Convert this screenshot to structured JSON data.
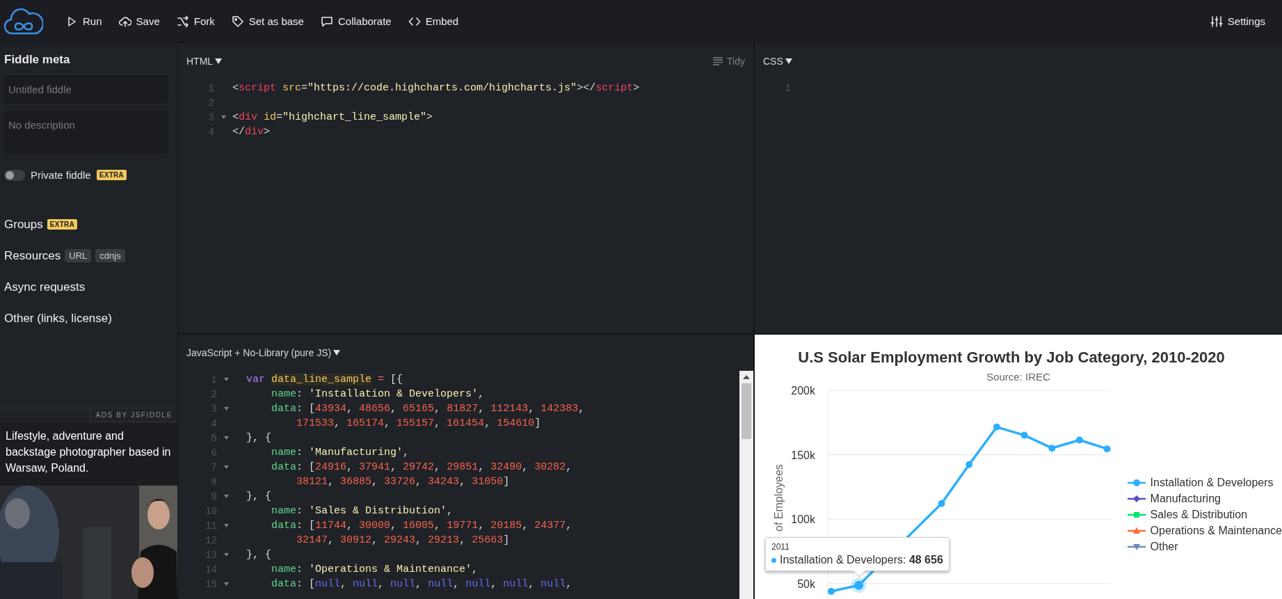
{
  "toolbar": {
    "actions": [
      {
        "label": "Run"
      },
      {
        "label": "Save"
      },
      {
        "label": "Fork"
      },
      {
        "label": "Set as base"
      },
      {
        "label": "Collaborate"
      },
      {
        "label": "Embed"
      }
    ],
    "settings": {
      "label": "Settings"
    }
  },
  "sidebar": {
    "title": "Fiddle meta",
    "title_field": {
      "placeholder": "Untitled fiddle"
    },
    "description_field": {
      "placeholder": "No description"
    },
    "private_toggle": {
      "label": "Private fiddle",
      "on": false,
      "badge": "EXTRA"
    },
    "sections": [
      {
        "label": "Groups",
        "badges": [
          {
            "text": "EXTRA",
            "kind": "extra"
          }
        ]
      },
      {
        "label": "Resources",
        "badges": [
          {
            "text": "URL",
            "kind": "tag"
          },
          {
            "text": "cdnjs",
            "kind": "tag"
          }
        ]
      },
      {
        "label": "Async requests"
      },
      {
        "label": "Other (links, license)"
      }
    ],
    "ad": {
      "label": "ADS BY JSFIDDLE",
      "text": "Lifestyle, adventure and backstage photographer based in Warsaw, Poland."
    }
  },
  "editors": {
    "html": {
      "title": "HTML",
      "tidy": "Tidy",
      "lines": [
        {
          "num": "1",
          "fold": false,
          "tokens": [
            {
              "kind": "punct",
              "text": "<"
            },
            {
              "kind": "tag",
              "text": "script"
            },
            {
              "kind": "attr",
              "text": " src"
            },
            {
              "kind": "punct",
              "text": "="
            },
            {
              "kind": "string",
              "text": "\"https://code.highcharts.com/highcharts.js\""
            },
            {
              "kind": "punct",
              "text": "></"
            },
            {
              "kind": "tag",
              "text": "script"
            },
            {
              "kind": "punct",
              "text": ">"
            }
          ]
        },
        {
          "num": "2",
          "fold": false
        },
        {
          "num": "3",
          "fold": true,
          "tokens": [
            {
              "kind": "punct",
              "text": "<"
            },
            {
              "kind": "tag",
              "text": "div"
            },
            {
              "kind": "attr",
              "text": " id"
            },
            {
              "kind": "punct",
              "text": "="
            },
            {
              "kind": "string",
              "text": "\"highchart_line_sample\""
            },
            {
              "kind": "punct",
              "text": ">"
            }
          ]
        },
        {
          "num": "4",
          "fold": false,
          "tokens": [
            {
              "kind": "punct",
              "text": "</"
            },
            {
              "kind": "tag",
              "text": "div"
            },
            {
              "kind": "punct",
              "text": ">"
            }
          ]
        }
      ]
    },
    "css": {
      "title": "CSS",
      "lines": [
        {
          "num": "1",
          "fold": false
        }
      ]
    },
    "js": {
      "title": "JavaScript + No-Library (pure JS)",
      "lines": [
        {
          "num": "1",
          "fold": true,
          "tokens": [
            {
              "kind": "keyword",
              "text": "var "
            },
            {
              "kind": "match",
              "text": "data_line_sample"
            },
            {
              "kind": "operator",
              "text": " = "
            },
            {
              "kind": "punct",
              "text": "[{"
            }
          ]
        },
        {
          "num": "2",
          "fold": false,
          "tokens": [
            {
              "kind": "property",
              "text": "    name"
            },
            {
              "kind": "punct",
              "text": ": "
            },
            {
              "kind": "string",
              "text": "'Installation & Developers'"
            },
            {
              "kind": "punct",
              "text": ","
            }
          ]
        },
        {
          "num": "3",
          "fold": true,
          "tokens": [
            {
              "kind": "property",
              "text": "    data"
            },
            {
              "kind": "punct",
              "text": ": ["
            },
            {
              "kind": "number",
              "text": "43934"
            },
            {
              "kind": "punct",
              "text": ", "
            },
            {
              "kind": "number",
              "text": "48656"
            },
            {
              "kind": "punct",
              "text": ", "
            },
            {
              "kind": "number",
              "text": "65165"
            },
            {
              "kind": "punct",
              "text": ", "
            },
            {
              "kind": "number",
              "text": "81827"
            },
            {
              "kind": "punct",
              "text": ", "
            },
            {
              "kind": "number",
              "text": "112143"
            },
            {
              "kind": "punct",
              "text": ", "
            },
            {
              "kind": "number",
              "text": "142383"
            },
            {
              "kind": "punct",
              "text": ","
            }
          ]
        },
        {
          "num": "4",
          "fold": false,
          "tokens": [
            {
              "kind": "number",
              "text": "        171533"
            },
            {
              "kind": "punct",
              "text": ", "
            },
            {
              "kind": "number",
              "text": "165174"
            },
            {
              "kind": "punct",
              "text": ", "
            },
            {
              "kind": "number",
              "text": "155157"
            },
            {
              "kind": "punct",
              "text": ", "
            },
            {
              "kind": "number",
              "text": "161454"
            },
            {
              "kind": "punct",
              "text": ", "
            },
            {
              "kind": "number",
              "text": "154610"
            },
            {
              "kind": "punct",
              "text": "]"
            }
          ]
        },
        {
          "num": "5",
          "fold": true,
          "tokens": [
            {
              "kind": "punct",
              "text": "}, {"
            }
          ]
        },
        {
          "num": "6",
          "fold": false,
          "tokens": [
            {
              "kind": "property",
              "text": "    name"
            },
            {
              "kind": "punct",
              "text": ": "
            },
            {
              "kind": "string",
              "text": "'Manufacturing'"
            },
            {
              "kind": "punct",
              "text": ","
            }
          ]
        },
        {
          "num": "7",
          "fold": true,
          "tokens": [
            {
              "kind": "property",
              "text": "    data"
            },
            {
              "kind": "punct",
              "text": ": ["
            },
            {
              "kind": "number",
              "text": "24916"
            },
            {
              "kind": "punct",
              "text": ", "
            },
            {
              "kind": "number",
              "text": "37941"
            },
            {
              "kind": "punct",
              "text": ", "
            },
            {
              "kind": "number",
              "text": "29742"
            },
            {
              "kind": "punct",
              "text": ", "
            },
            {
              "kind": "number",
              "text": "29851"
            },
            {
              "kind": "punct",
              "text": ", "
            },
            {
              "kind": "number",
              "text": "32490"
            },
            {
              "kind": "punct",
              "text": ", "
            },
            {
              "kind": "number",
              "text": "30282"
            },
            {
              "kind": "punct",
              "text": ","
            }
          ]
        },
        {
          "num": "8",
          "fold": false,
          "tokens": [
            {
              "kind": "number",
              "text": "        38121"
            },
            {
              "kind": "punct",
              "text": ", "
            },
            {
              "kind": "number",
              "text": "36885"
            },
            {
              "kind": "punct",
              "text": ", "
            },
            {
              "kind": "number",
              "text": "33726"
            },
            {
              "kind": "punct",
              "text": ", "
            },
            {
              "kind": "number",
              "text": "34243"
            },
            {
              "kind": "punct",
              "text": ", "
            },
            {
              "kind": "number",
              "text": "31050"
            },
            {
              "kind": "punct",
              "text": "]"
            }
          ]
        },
        {
          "num": "9",
          "fold": true,
          "tokens": [
            {
              "kind": "punct",
              "text": "}, {"
            }
          ]
        },
        {
          "num": "10",
          "fold": false,
          "tokens": [
            {
              "kind": "property",
              "text": "    name"
            },
            {
              "kind": "punct",
              "text": ": "
            },
            {
              "kind": "string",
              "text": "'Sales & Distribution'"
            },
            {
              "kind": "punct",
              "text": ","
            }
          ]
        },
        {
          "num": "11",
          "fold": true,
          "tokens": [
            {
              "kind": "property",
              "text": "    data"
            },
            {
              "kind": "punct",
              "text": ": ["
            },
            {
              "kind": "number",
              "text": "11744"
            },
            {
              "kind": "punct",
              "text": ", "
            },
            {
              "kind": "number",
              "text": "30000"
            },
            {
              "kind": "punct",
              "text": ", "
            },
            {
              "kind": "number",
              "text": "16005"
            },
            {
              "kind": "punct",
              "text": ", "
            },
            {
              "kind": "number",
              "text": "19771"
            },
            {
              "kind": "punct",
              "text": ", "
            },
            {
              "kind": "number",
              "text": "20185"
            },
            {
              "kind": "punct",
              "text": ", "
            },
            {
              "kind": "number",
              "text": "24377"
            },
            {
              "kind": "punct",
              "text": ","
            }
          ]
        },
        {
          "num": "12",
          "fold": false,
          "tokens": [
            {
              "kind": "number",
              "text": "        32147"
            },
            {
              "kind": "punct",
              "text": ", "
            },
            {
              "kind": "number",
              "text": "30912"
            },
            {
              "kind": "punct",
              "text": ", "
            },
            {
              "kind": "number",
              "text": "29243"
            },
            {
              "kind": "punct",
              "text": ", "
            },
            {
              "kind": "number",
              "text": "29213"
            },
            {
              "kind": "punct",
              "text": ", "
            },
            {
              "kind": "number",
              "text": "25663"
            },
            {
              "kind": "punct",
              "text": "]"
            }
          ]
        },
        {
          "num": "13",
          "fold": true,
          "tokens": [
            {
              "kind": "punct",
              "text": "}, {"
            }
          ]
        },
        {
          "num": "14",
          "fold": false,
          "tokens": [
            {
              "kind": "property",
              "text": "    name"
            },
            {
              "kind": "punct",
              "text": ": "
            },
            {
              "kind": "string",
              "text": "'Operations & Maintenance'"
            },
            {
              "kind": "punct",
              "text": ","
            }
          ]
        },
        {
          "num": "15",
          "fold": true,
          "tokens": [
            {
              "kind": "property",
              "text": "    data"
            },
            {
              "kind": "punct",
              "text": ": ["
            },
            {
              "kind": "null",
              "text": "null"
            },
            {
              "kind": "punct",
              "text": ", "
            },
            {
              "kind": "null",
              "text": "null"
            },
            {
              "kind": "punct",
              "text": ", "
            },
            {
              "kind": "null",
              "text": "null"
            },
            {
              "kind": "punct",
              "text": ", "
            },
            {
              "kind": "null",
              "text": "null"
            },
            {
              "kind": "punct",
              "text": ", "
            },
            {
              "kind": "null",
              "text": "null"
            },
            {
              "kind": "punct",
              "text": ", "
            },
            {
              "kind": "null",
              "text": "null"
            },
            {
              "kind": "punct",
              "text": ", "
            },
            {
              "kind": "null",
              "text": "null"
            },
            {
              "kind": "punct",
              "text": ","
            }
          ]
        }
      ]
    }
  },
  "result": {
    "chart_data": {
      "type": "line",
      "title": "U.S Solar Employment Growth by Job Category, 2010-2020",
      "ylabel": "of Employees",
      "grid": true,
      "ylim": [
        40800,
        200000
      ],
      "yticks": [
        {
          "value": 50000,
          "label": "50k"
        },
        {
          "value": 100000,
          "label": "100k"
        },
        {
          "value": 150000,
          "label": "150k"
        },
        {
          "value": 200000,
          "label": "200k"
        }
      ],
      "series": [
        {
          "color": "#2caffe",
          "marker": "circle",
          "values": [
            43934,
            48656,
            null,
            null,
            112143,
            142383,
            171533,
            165174,
            155157,
            161454,
            154610
          ]
        }
      ]
    },
    "subtitle": "Source: IREC",
    "legend": [
      {
        "label": "Installation & Developers",
        "color": "#2caffe",
        "kind": "circle"
      },
      {
        "label": "Manufacturing",
        "color": "#544fc5",
        "kind": "diamond"
      },
      {
        "label": "Sales & Distribution",
        "color": "#00e272",
        "kind": "square"
      },
      {
        "label": "Operations & Maintenance",
        "color": "#fe6a35",
        "kind": "triangle"
      },
      {
        "label": "Other",
        "color": "#6b8abc",
        "kind": "triangle-down"
      }
    ],
    "points": [
      {
        "hovered": false
      },
      {
        "hovered": true
      },
      {
        "hovered": false
      },
      {
        "hovered": false
      },
      {
        "hovered": false
      },
      {
        "hovered": false
      },
      {
        "hovered": false
      },
      {
        "hovered": false
      },
      {
        "hovered": false
      },
      {
        "hovered": false
      },
      {
        "hovered": false
      }
    ],
    "tooltip": {
      "title": "2011",
      "text": "Installation & Developers: **48 656**",
      "color": "#2caffe"
    }
  }
}
